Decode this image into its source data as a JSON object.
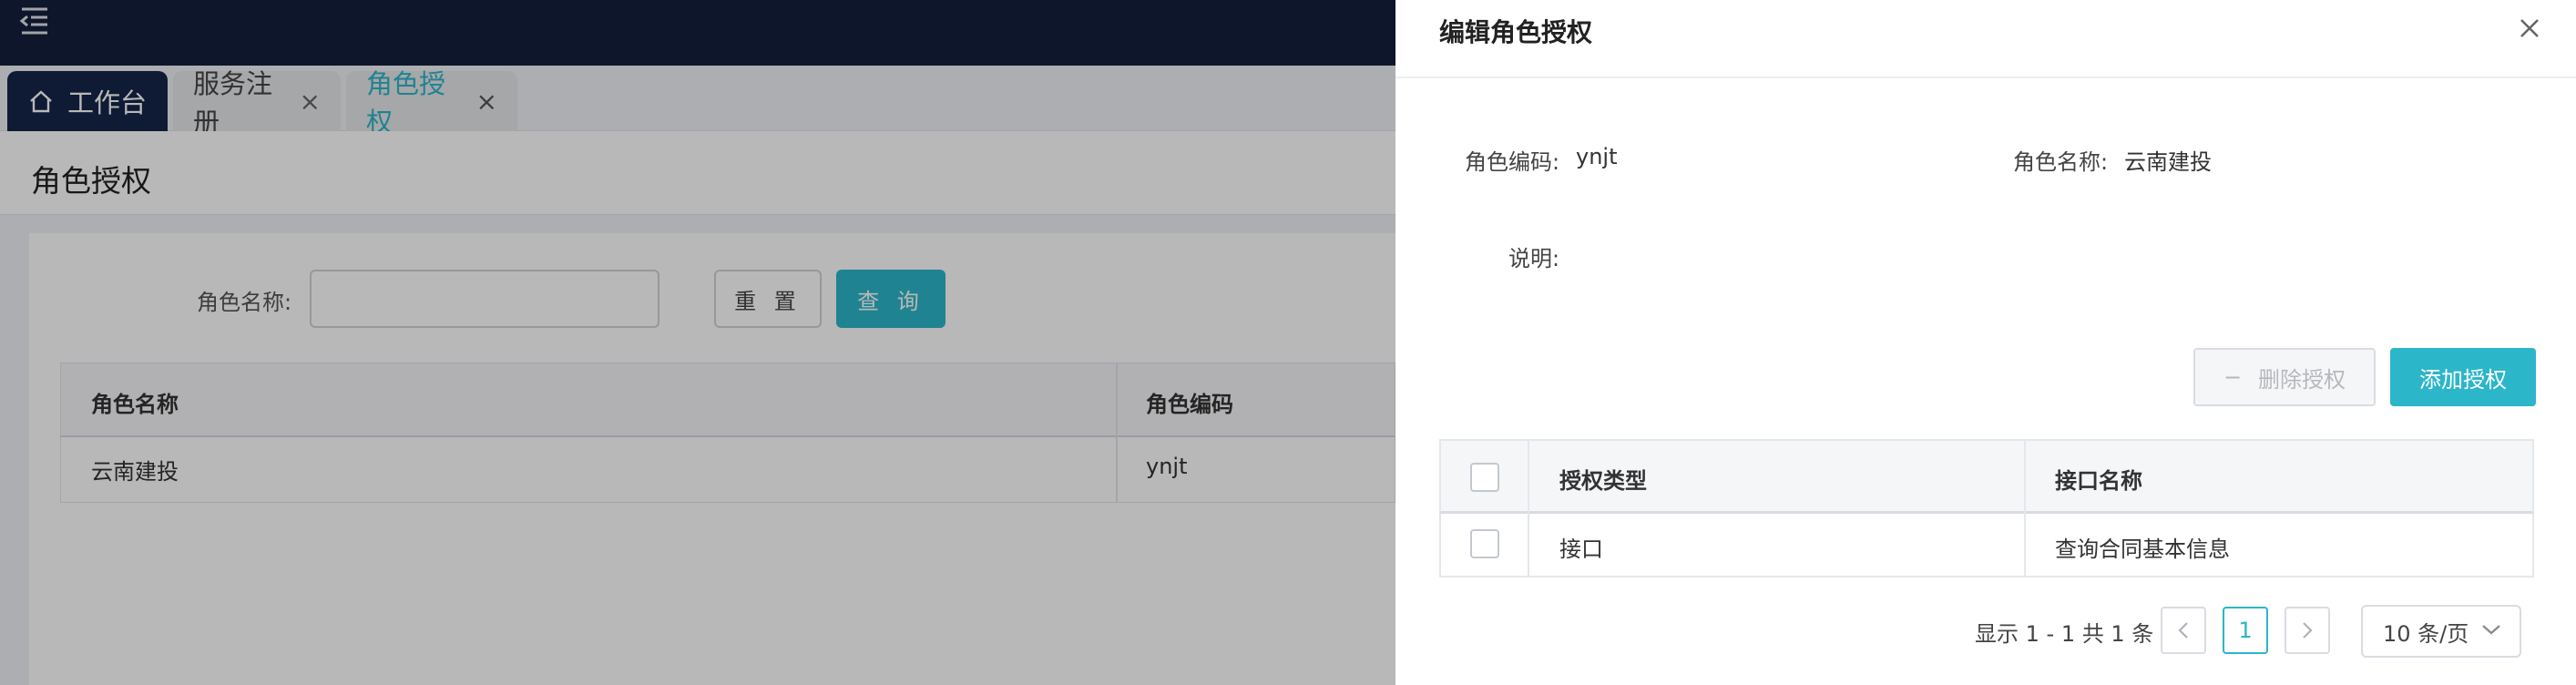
{
  "app": {
    "tabs": [
      {
        "label": "工作台",
        "active": true,
        "closable": false,
        "icon": "home-icon"
      },
      {
        "label": "服务注册",
        "active": false,
        "closable": true
      },
      {
        "label": "角色授权",
        "active": false,
        "current": true,
        "closable": true
      }
    ],
    "close_glyph": "×",
    "page_title": "角色授权",
    "search": {
      "label": "角色名称:",
      "value": "",
      "placeholder": ""
    },
    "buttons": {
      "reset": "重 置",
      "query": "查 询"
    },
    "table": {
      "headers": [
        "角色名称",
        "角色编码"
      ],
      "rows": [
        [
          "云南建投",
          "ynjt"
        ]
      ]
    }
  },
  "drawer": {
    "title": "编辑角色授权",
    "fields": {
      "code_label": "角色编码:",
      "code_value": "ynjt",
      "name_label": "角色名称:",
      "name_value": "云南建投",
      "desc_label": "说明:",
      "desc_value": ""
    },
    "buttons": {
      "delete_icon": "−",
      "delete": "删除授权",
      "add": "添加授权"
    },
    "table": {
      "headers": [
        "授权类型",
        "接口名称"
      ],
      "rows": [
        [
          "接口",
          "查询合同基本信息"
        ]
      ]
    },
    "pagination": {
      "total_text": "显示 1 - 1 共 1 条",
      "current_page": "1",
      "page_size": "10 条/页"
    }
  },
  "colors": {
    "accent": "#2bb6c9",
    "topbar": "#121f3b",
    "tab_active": "#16244a"
  }
}
